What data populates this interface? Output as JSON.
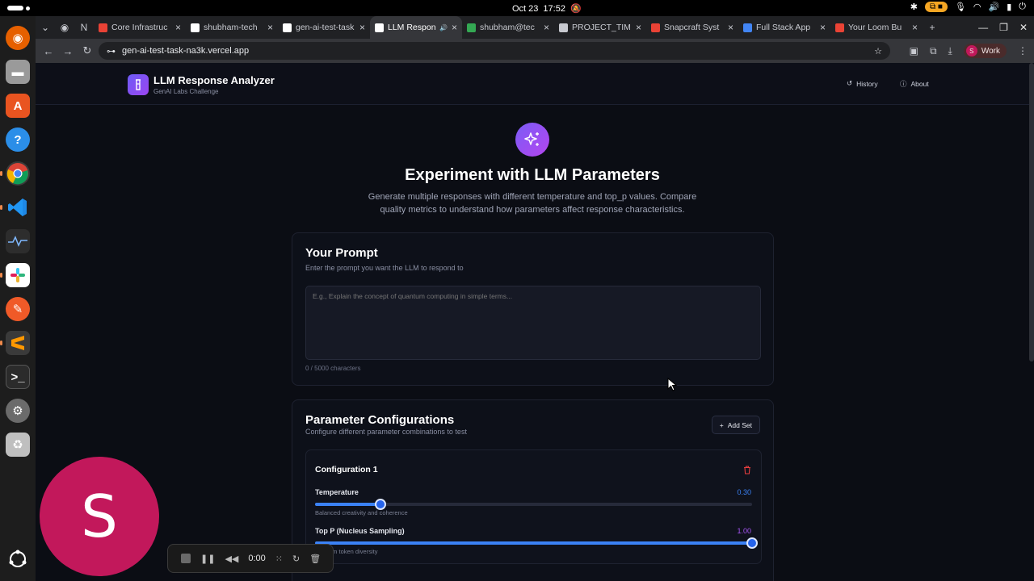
{
  "system": {
    "date": "Oct 23",
    "time": "17:52"
  },
  "browser": {
    "tabs": [
      {
        "title": "Core Infrastruc",
        "color": "#e94235"
      },
      {
        "title": "shubham-tech",
        "color": "#ffffff"
      },
      {
        "title": "gen-ai-test-task",
        "color": "#ffffff"
      },
      {
        "title": "LLM Respon",
        "color": "#ffffff"
      },
      {
        "title": "shubham@tec",
        "color": "#34a853"
      },
      {
        "title": "PROJECT_TIM",
        "color": "#c8cad0"
      },
      {
        "title": "Snapcraft Syst",
        "color": "#e94235"
      },
      {
        "title": "Full Stack App",
        "color": "#4285f4"
      },
      {
        "title": "Your Loom Bu",
        "color": "#ea4335"
      }
    ],
    "url": "gen-ai-test-task-na3k.vercel.app",
    "profile_label": "Work",
    "profile_initial": "S"
  },
  "app": {
    "title": "LLM Response Analyzer",
    "subtitle": "GenAI Labs Challenge",
    "nav": {
      "history": "History",
      "about": "About"
    }
  },
  "hero": {
    "title": "Experiment with LLM Parameters",
    "description": "Generate multiple responses with different temperature and top_p values. Compare quality metrics to understand how parameters affect response characteristics."
  },
  "prompt": {
    "title": "Your Prompt",
    "subtitle": "Enter the prompt you want the LLM to respond to",
    "placeholder": "E.g., Explain the concept of quantum computing in simple terms...",
    "value": "",
    "char_count": "0 / 5000 characters"
  },
  "params": {
    "title": "Parameter Configurations",
    "subtitle": "Configure different parameter combinations to test",
    "add_label": "Add Set",
    "configs": [
      {
        "name": "Configuration 1",
        "temperature": {
          "label": "Temperature",
          "value": 0.3,
          "display": "0.30",
          "help": "Balanced creativity and coherence",
          "max": 2,
          "color": "#3b82f6"
        },
        "top_p": {
          "label": "Top P (Nucleus Sampling)",
          "value": 1.0,
          "display": "1.00",
          "help": "um token diversity",
          "max": 1,
          "color": "#a855f7"
        }
      }
    ]
  },
  "overlay": {
    "avatar_letter": "S",
    "recorder_time": "0:00"
  }
}
